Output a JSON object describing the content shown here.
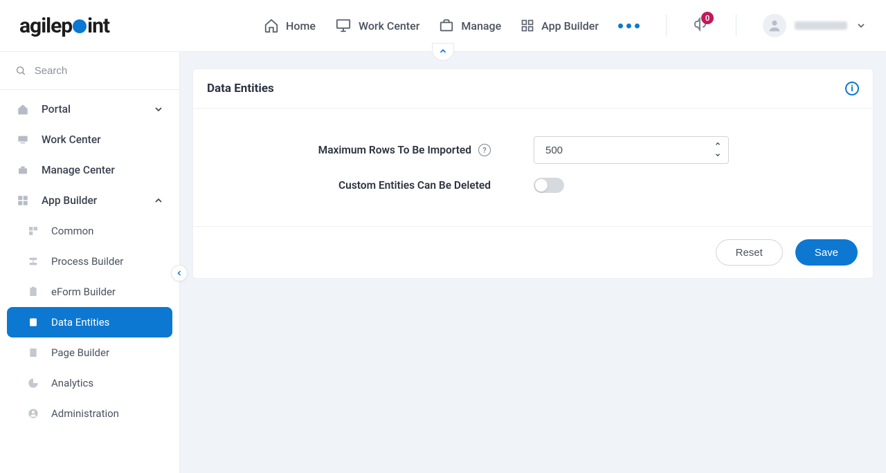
{
  "brand": {
    "p1": "agilep",
    "p2": "int"
  },
  "nav": {
    "home": "Home",
    "work_center": "Work Center",
    "manage": "Manage",
    "app_builder": "App Builder"
  },
  "notif_count": "0",
  "search_placeholder": "Search",
  "sidebar": {
    "portal": "Portal",
    "work_center": "Work Center",
    "manage_center": "Manage Center",
    "app_builder": "App Builder",
    "common": "Common",
    "process_builder": "Process Builder",
    "eform_builder": "eForm Builder",
    "data_entities": "Data Entities",
    "page_builder": "Page Builder",
    "analytics": "Analytics",
    "administration": "Administration"
  },
  "page": {
    "title": "Data Entities",
    "max_rows_label": "Maximum Rows To Be Imported",
    "max_rows_value": "500",
    "custom_delete_label": "Custom Entities Can Be Deleted",
    "reset": "Reset",
    "save": "Save"
  },
  "colors": {
    "accent": "#0c78d1",
    "badge": "#c2185b"
  }
}
